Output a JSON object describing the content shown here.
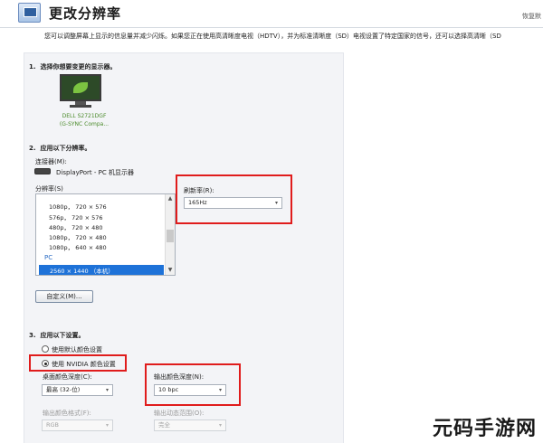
{
  "header": {
    "title": "更改分辨率",
    "restore_link": "恢复默",
    "description": "您可以调整屏幕上显示的信息量并减少闪烁。如果您正在使用高清晰度电视（HDTV），并为标准清晰度（SD）电视设置了特定国家的信号，还可以选择高清晰（SD"
  },
  "section1": {
    "number": "1.",
    "title": "选择你想要变更的显示器。",
    "monitor_line1": "DELL S2721DGF",
    "monitor_line2": "(G-SYNC Compa..."
  },
  "section2": {
    "number": "2.",
    "title": "应用以下分辨率。",
    "connector_label": "连接器(M):",
    "connector_value": "DisplayPort - PC 机显示器",
    "resolution_label": "分辨率(S)",
    "resolution_items": [
      "1080p， 720 × 576",
      "576p， 720 × 576",
      "480p， 720 × 480",
      "1080p， 720 × 480",
      "1080p， 640 × 480"
    ],
    "group_label": "PC",
    "selected_resolution": "2560 × 1440 （本机）",
    "refresh_label": "刷新率(R):",
    "refresh_value": "165Hz",
    "custom_button": "自定义(M)..."
  },
  "section3": {
    "number": "3.",
    "title": "应用以下设置。",
    "radio_default": "使用默认颜色设置",
    "radio_nvidia": "使用 NVIDIA 颜色设置",
    "desktop_depth_label": "桌面颜色深度(C):",
    "desktop_depth_value": "最高 (32-位)",
    "output_depth_label": "输出颜色深度(N):",
    "output_depth_value": "10 bpc",
    "output_format_label": "输出颜色格式(F):",
    "output_format_value": "RGB",
    "dynamic_range_label": "输出动态范围(O):",
    "dynamic_range_value": "完全"
  },
  "watermark": "元码手游网",
  "colors": {
    "highlight": "#e01c1c",
    "selection": "#1e72d8",
    "panel": "#f3f4f7"
  }
}
